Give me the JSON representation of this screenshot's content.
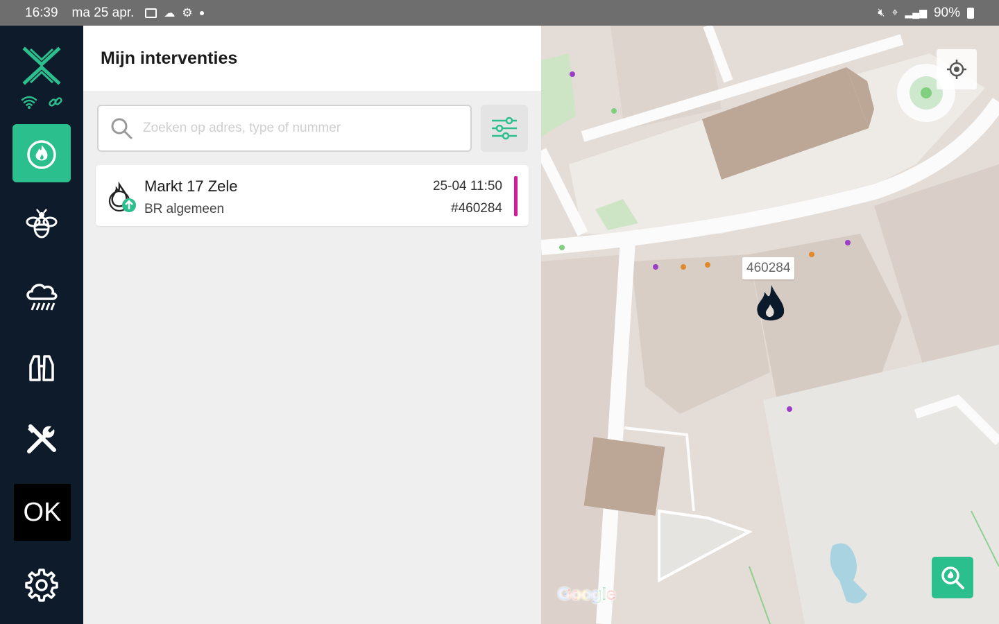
{
  "status_bar": {
    "time": "16:39",
    "date": "ma 25 apr.",
    "battery": "90%"
  },
  "sidebar": {
    "items": [
      {
        "name": "fire",
        "active": true
      },
      {
        "name": "bee"
      },
      {
        "name": "weather"
      },
      {
        "name": "binoculars"
      },
      {
        "name": "tools"
      },
      {
        "name": "ok",
        "label": "OK"
      },
      {
        "name": "settings"
      }
    ]
  },
  "panel": {
    "title": "Mijn interventies",
    "search_placeholder": "Zoeken op adres, type of nummer"
  },
  "interventions": [
    {
      "address": "Markt 17 Zele",
      "type": "BR algemeen",
      "datetime": "25-04 11:50",
      "number": "#460284",
      "accent_color": "#d6199b"
    }
  ],
  "map": {
    "marker_label": "460284",
    "attribution": "Google"
  },
  "colors": {
    "sidebar_bg": "#0e1b2b",
    "accent": "#2bbf8e"
  }
}
